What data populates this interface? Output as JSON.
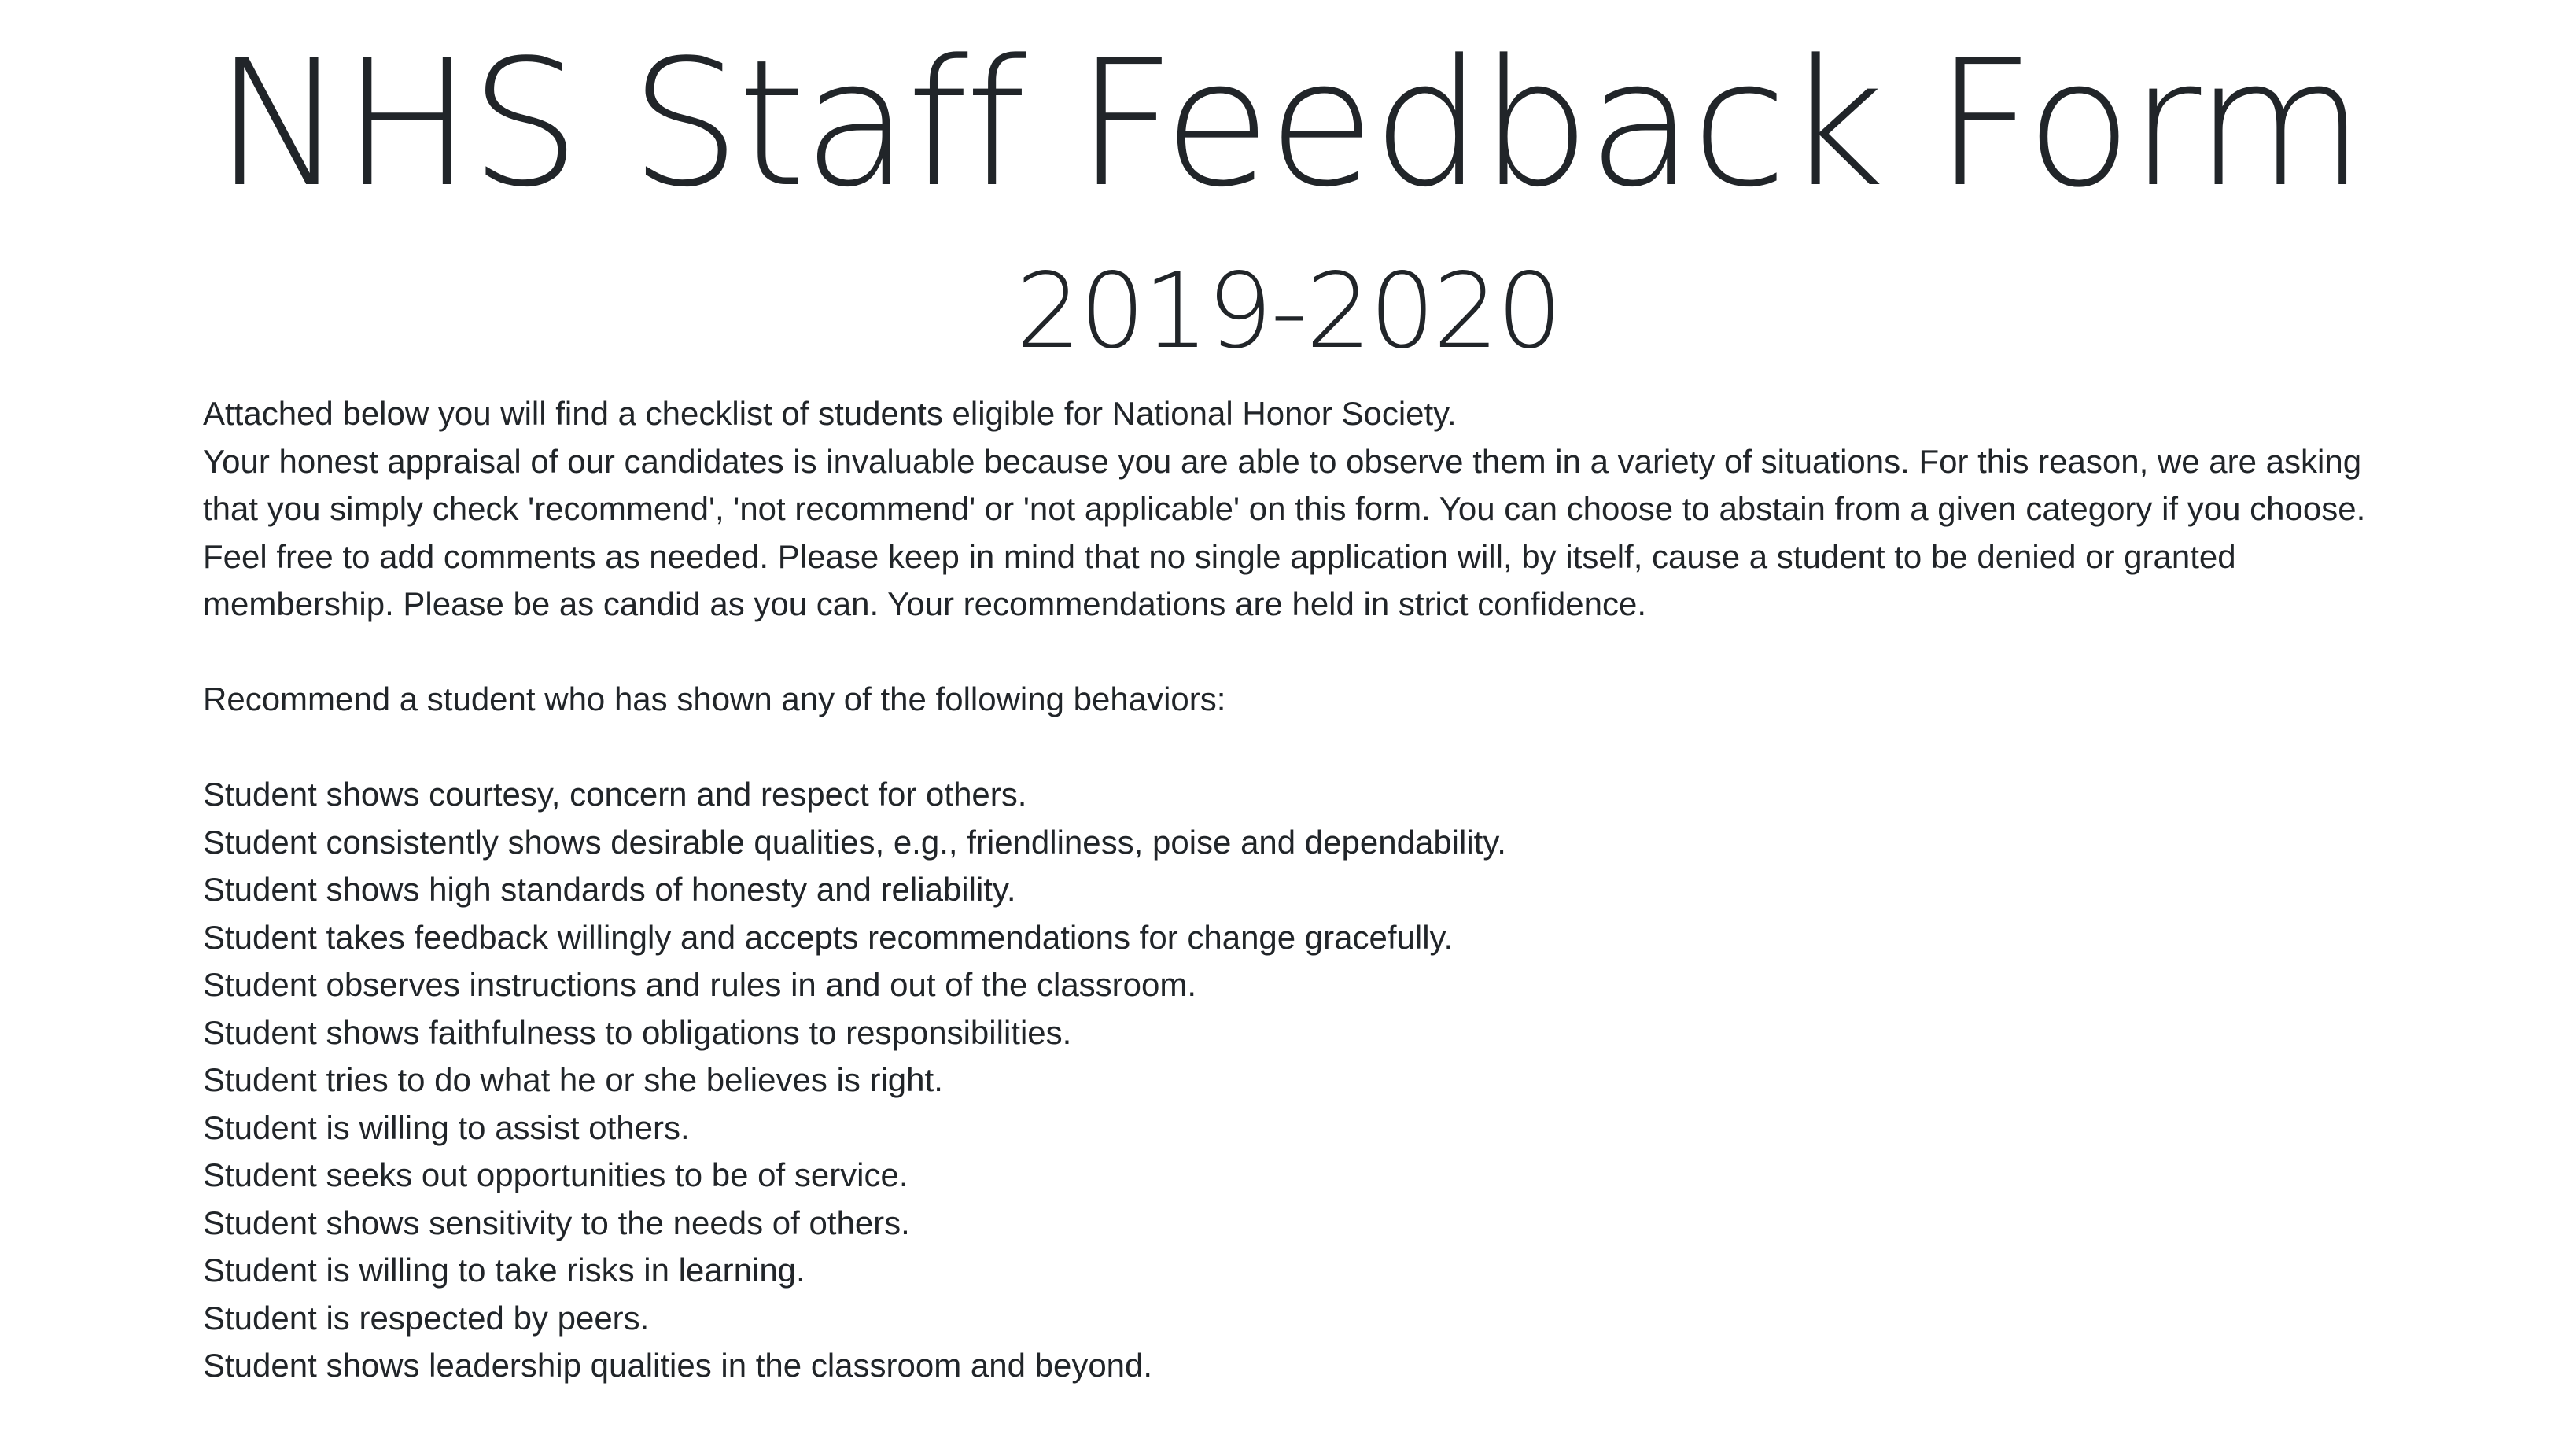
{
  "header": {
    "title": "NHS Staff Feedback Form",
    "subtitle": "2019-2020"
  },
  "intro": {
    "line1": "Attached below you will find a checklist of students eligible for National Honor Society.",
    "paragraph": "Your honest appraisal of our candidates is invaluable because you are able to observe them in a variety of situations. For this reason, we are asking that you simply check 'recommend', 'not recommend' or 'not applicable' on this form. You can choose to abstain from a given category if you choose. Feel free to add comments as needed. Please keep in mind that no single application will, by itself, cause a student to be denied or granted membership. Please be as candid as you can. Your recommendations are held in strict confidence."
  },
  "recommend_heading": "Recommend a student who has shown any of the following behaviors:",
  "behaviors": [
    "Student shows courtesy, concern and respect for others.",
    "Student consistently shows desirable qualities, e.g., friendliness, poise and dependability.",
    "Student shows high standards of honesty and reliability.",
    "Student takes feedback willingly and accepts recommendations for change gracefully.",
    "Student observes instructions and rules in and out of the classroom.",
    "Student shows faithfulness to obligations to responsibilities.",
    "Student tries to do what he or she believes is right.",
    "Student is willing to assist others.",
    "Student seeks out opportunities to be of service.",
    "Student shows sensitivity to the needs of others.",
    "Student is willing to take risks in learning.",
    "Student is respected by peers.",
    "Student shows leadership qualities in the classroom and beyond."
  ]
}
